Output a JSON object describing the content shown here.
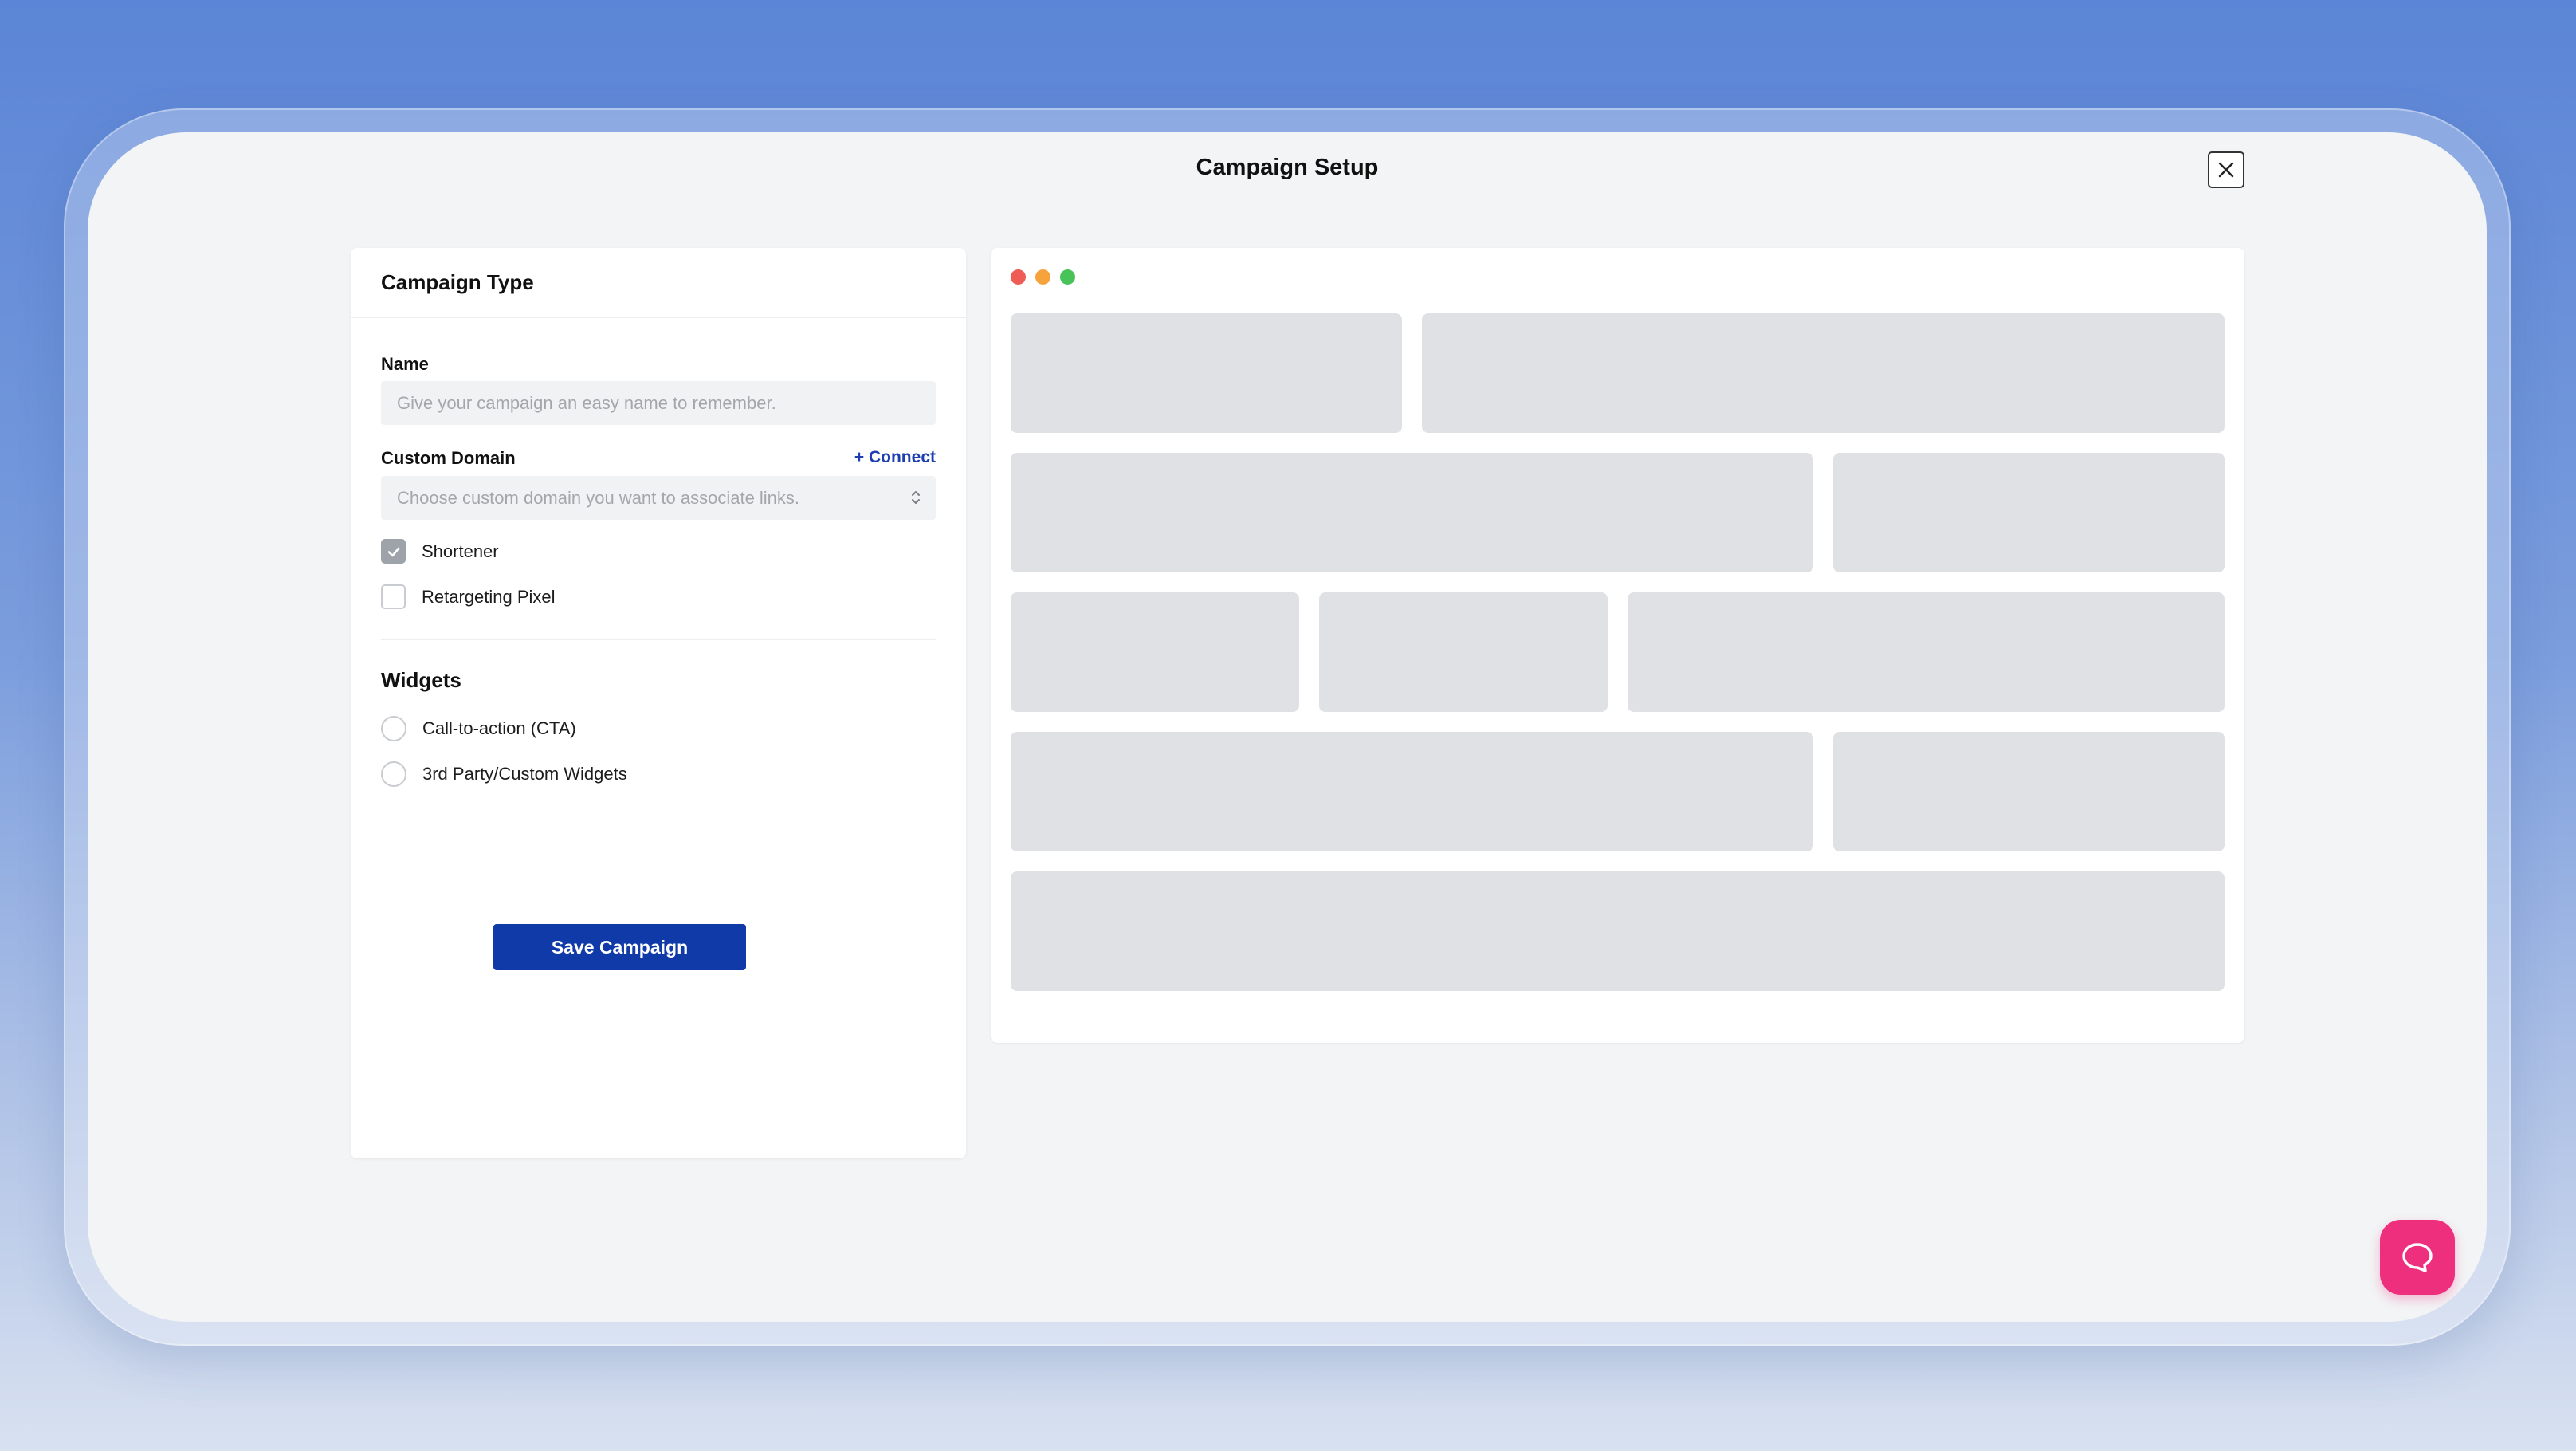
{
  "modal": {
    "title": "Campaign Setup",
    "close_icon": "close-icon"
  },
  "form": {
    "header": "Campaign Type",
    "name_label": "Name",
    "name_placeholder": "Give your campaign an easy name to remember.",
    "domain_label": "Custom Domain",
    "connect_label": "+ Connect",
    "domain_placeholder": "Choose custom domain you want to associate links.",
    "options": [
      {
        "label": "Shortener",
        "checked": true
      },
      {
        "label": "Retargeting Pixel",
        "checked": false
      }
    ],
    "widgets_title": "Widgets",
    "widgets": [
      {
        "label": "Call-to-action (CTA)",
        "selected": false
      },
      {
        "label": "3rd Party/Custom Widgets",
        "selected": false
      }
    ],
    "save_label": "Save Campaign"
  },
  "preview": {
    "window_dots": [
      "#ef5b55",
      "#f5a33a",
      "#48c35a"
    ]
  },
  "colors": {
    "accent": "#0f3aa8",
    "link": "#1d3fb0",
    "chat_button": "#ee2f7e",
    "placeholder_block": "#dfe1e5"
  },
  "chat": {
    "icon": "chat-bubble-icon"
  }
}
